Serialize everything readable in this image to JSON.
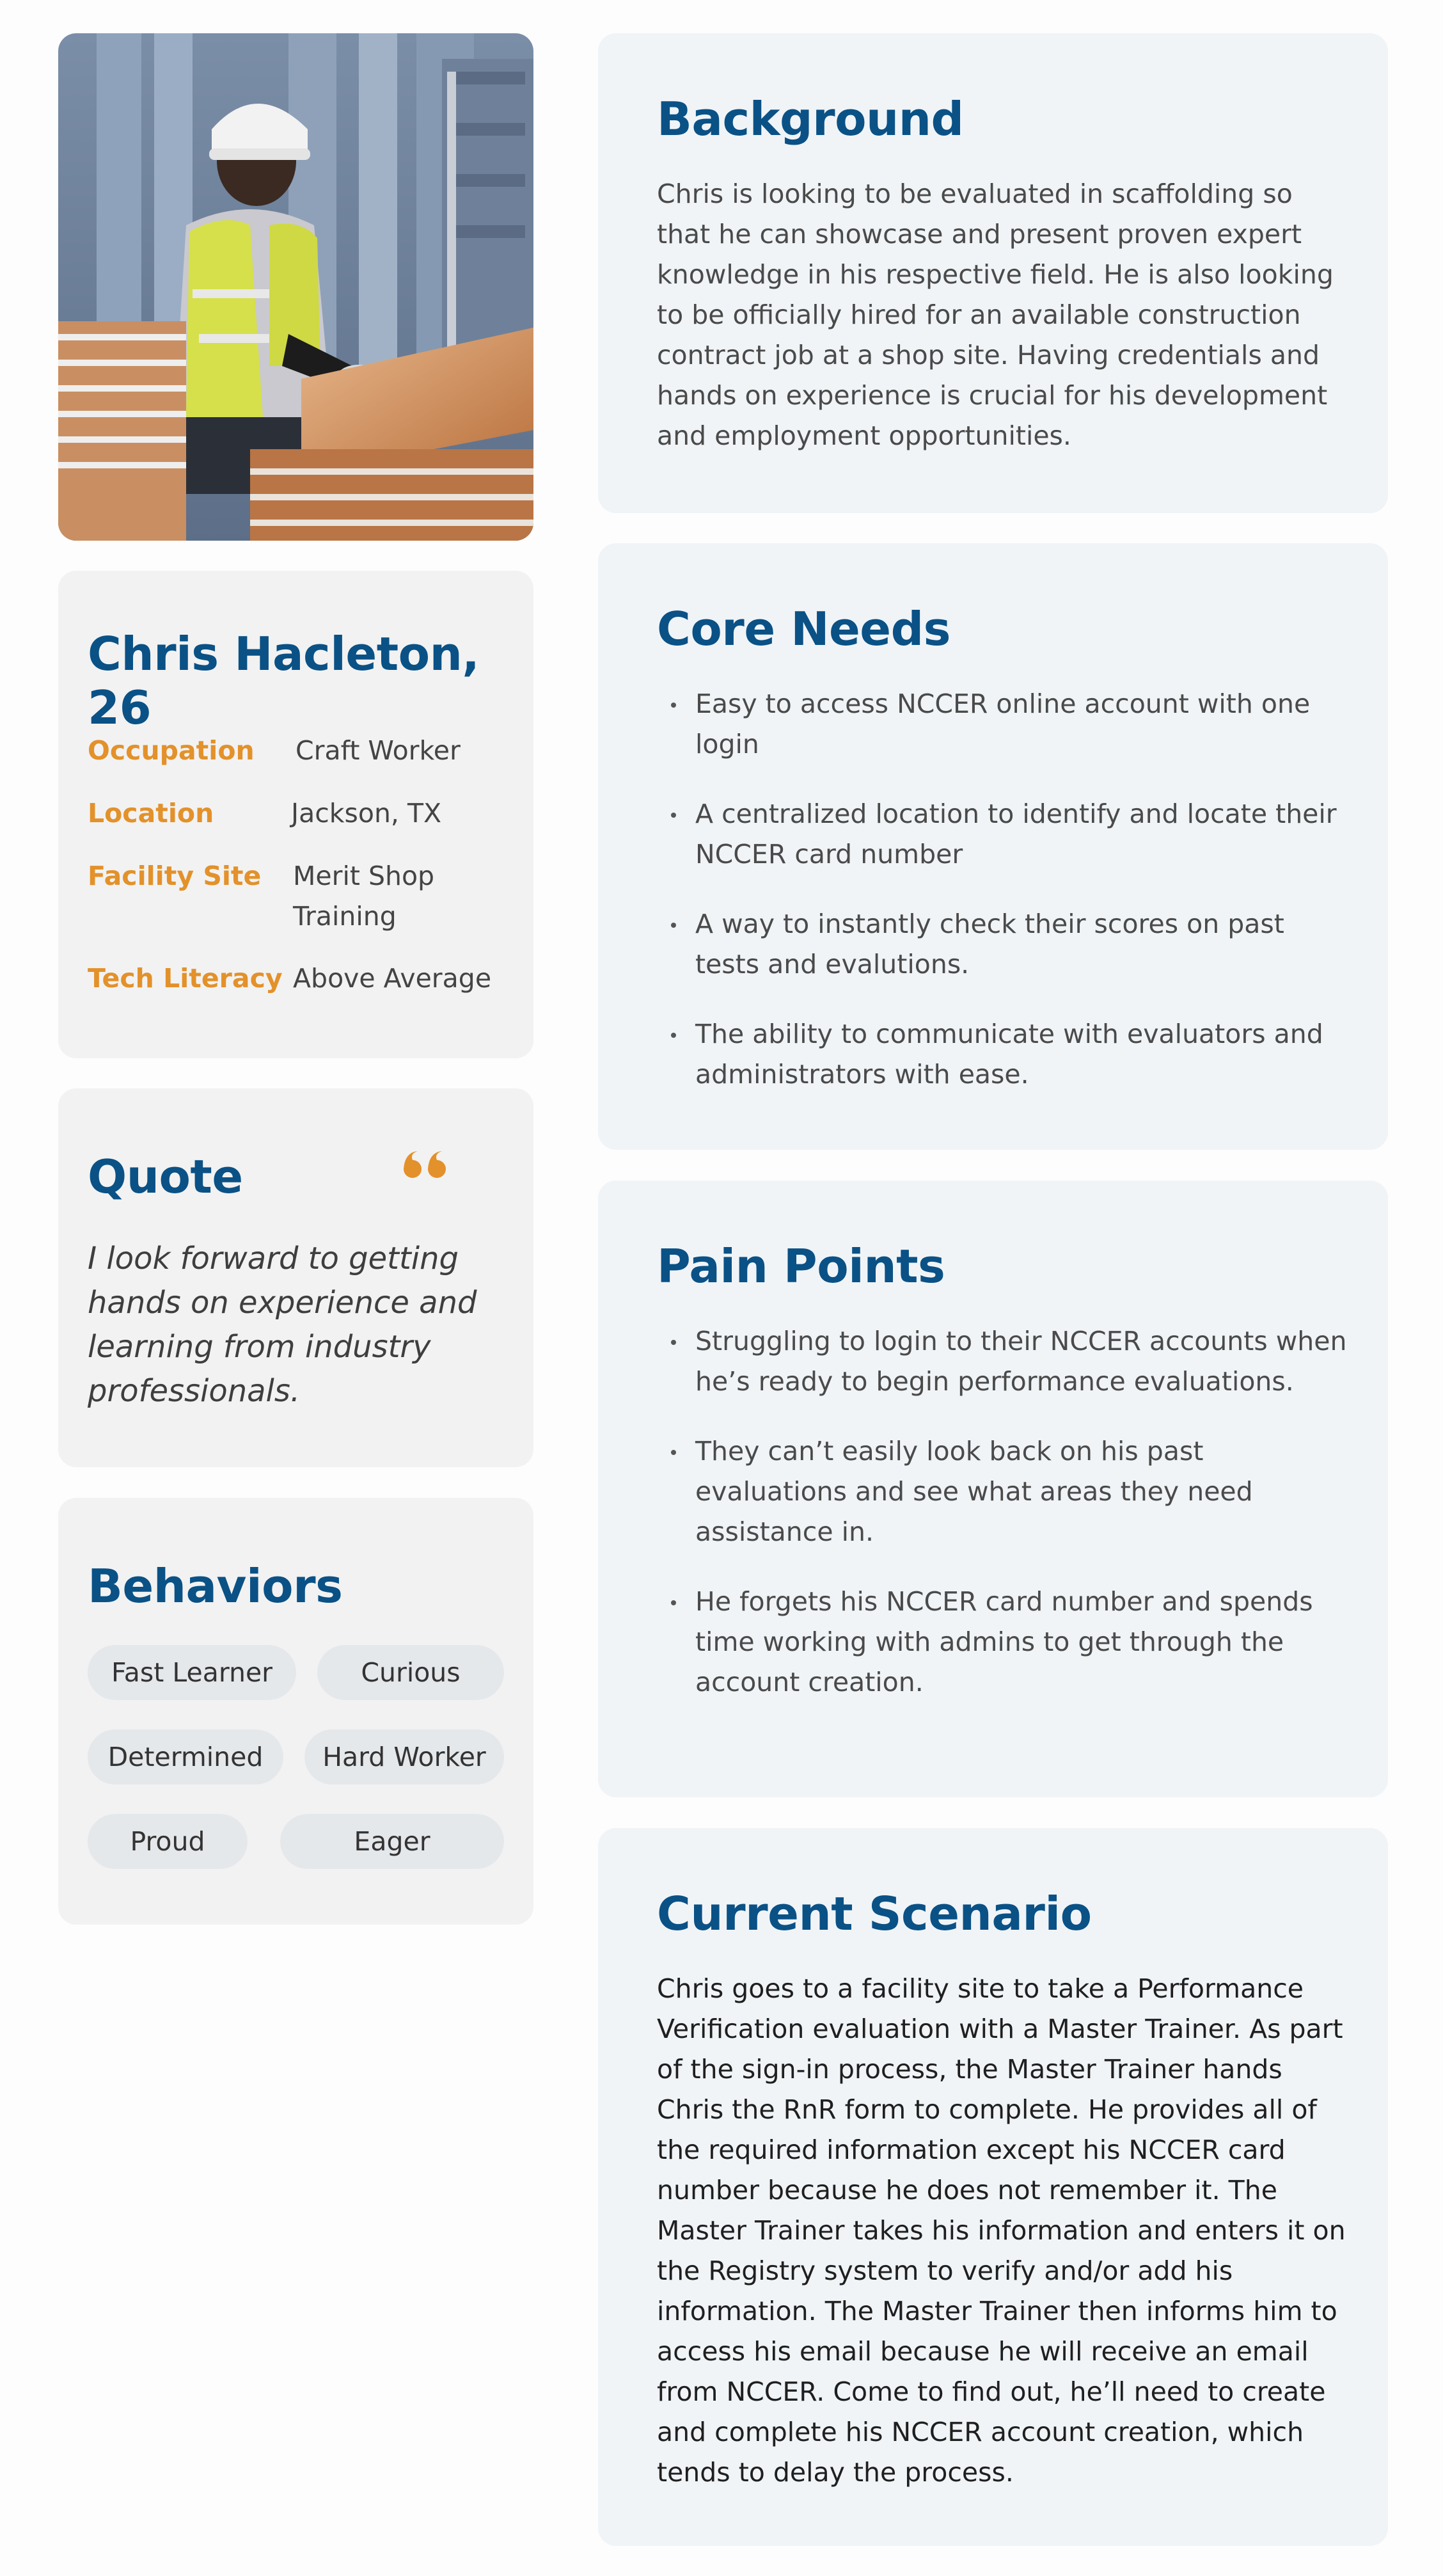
{
  "profile": {
    "name": "Chris Hacleton, 26",
    "fields": [
      {
        "label": "Occupation",
        "value": "Craft Worker"
      },
      {
        "label": "Location",
        "value": "Jackson, TX"
      },
      {
        "label": "Facility Site",
        "value": "Merit Shop Training"
      },
      {
        "label": "Tech Literacy",
        "value": "Above Average"
      }
    ]
  },
  "quote": {
    "title": "Quote",
    "text": "I look forward to getting hands on experience and learning from industry professionals."
  },
  "behaviors": {
    "title": "Behaviors",
    "tags": [
      "Fast Learner",
      "Curious",
      "Determined",
      "Hard Worker",
      "Proud",
      "Eager"
    ]
  },
  "background": {
    "title": "Background",
    "text": "Chris is looking to be evaluated in scaffolding so that he can showcase and present proven expert knowledge in his respective field. He is also looking to be officially hired for an available construction contract job at a shop site. Having credentials and hands on experience is crucial for his development and employment opportunities."
  },
  "core_needs": {
    "title": "Core Needs",
    "items": [
      "Easy to access NCCER online account with one login",
      "A centralized location to identify and locate their NCCER card number",
      "A way to instantly check their scores on past tests and evalutions.",
      "The ability to communicate with evaluators and administrators with ease."
    ]
  },
  "pain_points": {
    "title": "Pain Points",
    "items": [
      "Struggling to login to their NCCER accounts when he’s ready to begin performance evaluations.",
      "They can’t easily look back on his past evaluations and see what areas they need assistance in.",
      "He forgets his NCCER card number and spends time working with admins to get through the account creation."
    ]
  },
  "current_scenario": {
    "title": "Current Scenario",
    "text": "Chris goes to a facility site to take a Performance Verification evaluation with a Master Trainer. As part of the sign-in process, the Master Trainer hands Chris the RnR form to complete. He provides all of the required information except his NCCER card number because he does not remember it. The Master Trainer takes his information and enters it on the Registry system to verify and/or add his information. The Master Trainer then informs him to access his email because he will receive an email from NCCER. Come to find out, he’ll need to create and complete his NCCER account creation, which tends to delay the process."
  },
  "colors": {
    "heading": "#0a5186",
    "label_accent": "#e3912a",
    "left_card_bg": "#f2f2f2",
    "right_card_bg": "#f0f4f7",
    "pill_bg": "#e5e8eb"
  },
  "icons": {
    "quote_mark": "quote-mark-icon"
  }
}
